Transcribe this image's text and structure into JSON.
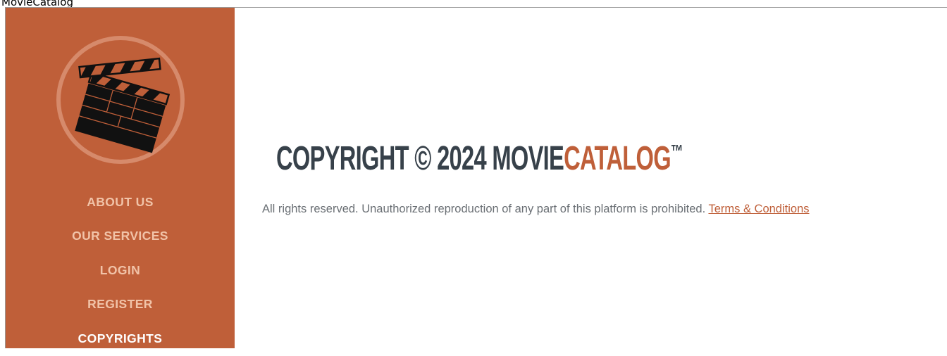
{
  "window": {
    "title": "MovieCatalog"
  },
  "brand": {
    "accent_color": "#bf5f39",
    "dark_text_color": "#37414a",
    "logo_icon": "clapperboard-icon"
  },
  "sidebar": {
    "items": [
      {
        "label": "ABOUT US",
        "active": false
      },
      {
        "label": "OUR SERVICES",
        "active": false
      },
      {
        "label": "LOGIN",
        "active": false
      },
      {
        "label": "REGISTER",
        "active": false
      },
      {
        "label": "COPYRIGHTS",
        "active": true
      }
    ]
  },
  "main": {
    "headline": {
      "prefix": "COPYRIGHT © 2024 MOVIE",
      "accent": "CATALOG",
      "trademark": "™"
    },
    "rights_text": "All rights reserved. Unauthorized reproduction of any part of this platform is prohibited.",
    "terms_link": "Terms & Conditions"
  }
}
